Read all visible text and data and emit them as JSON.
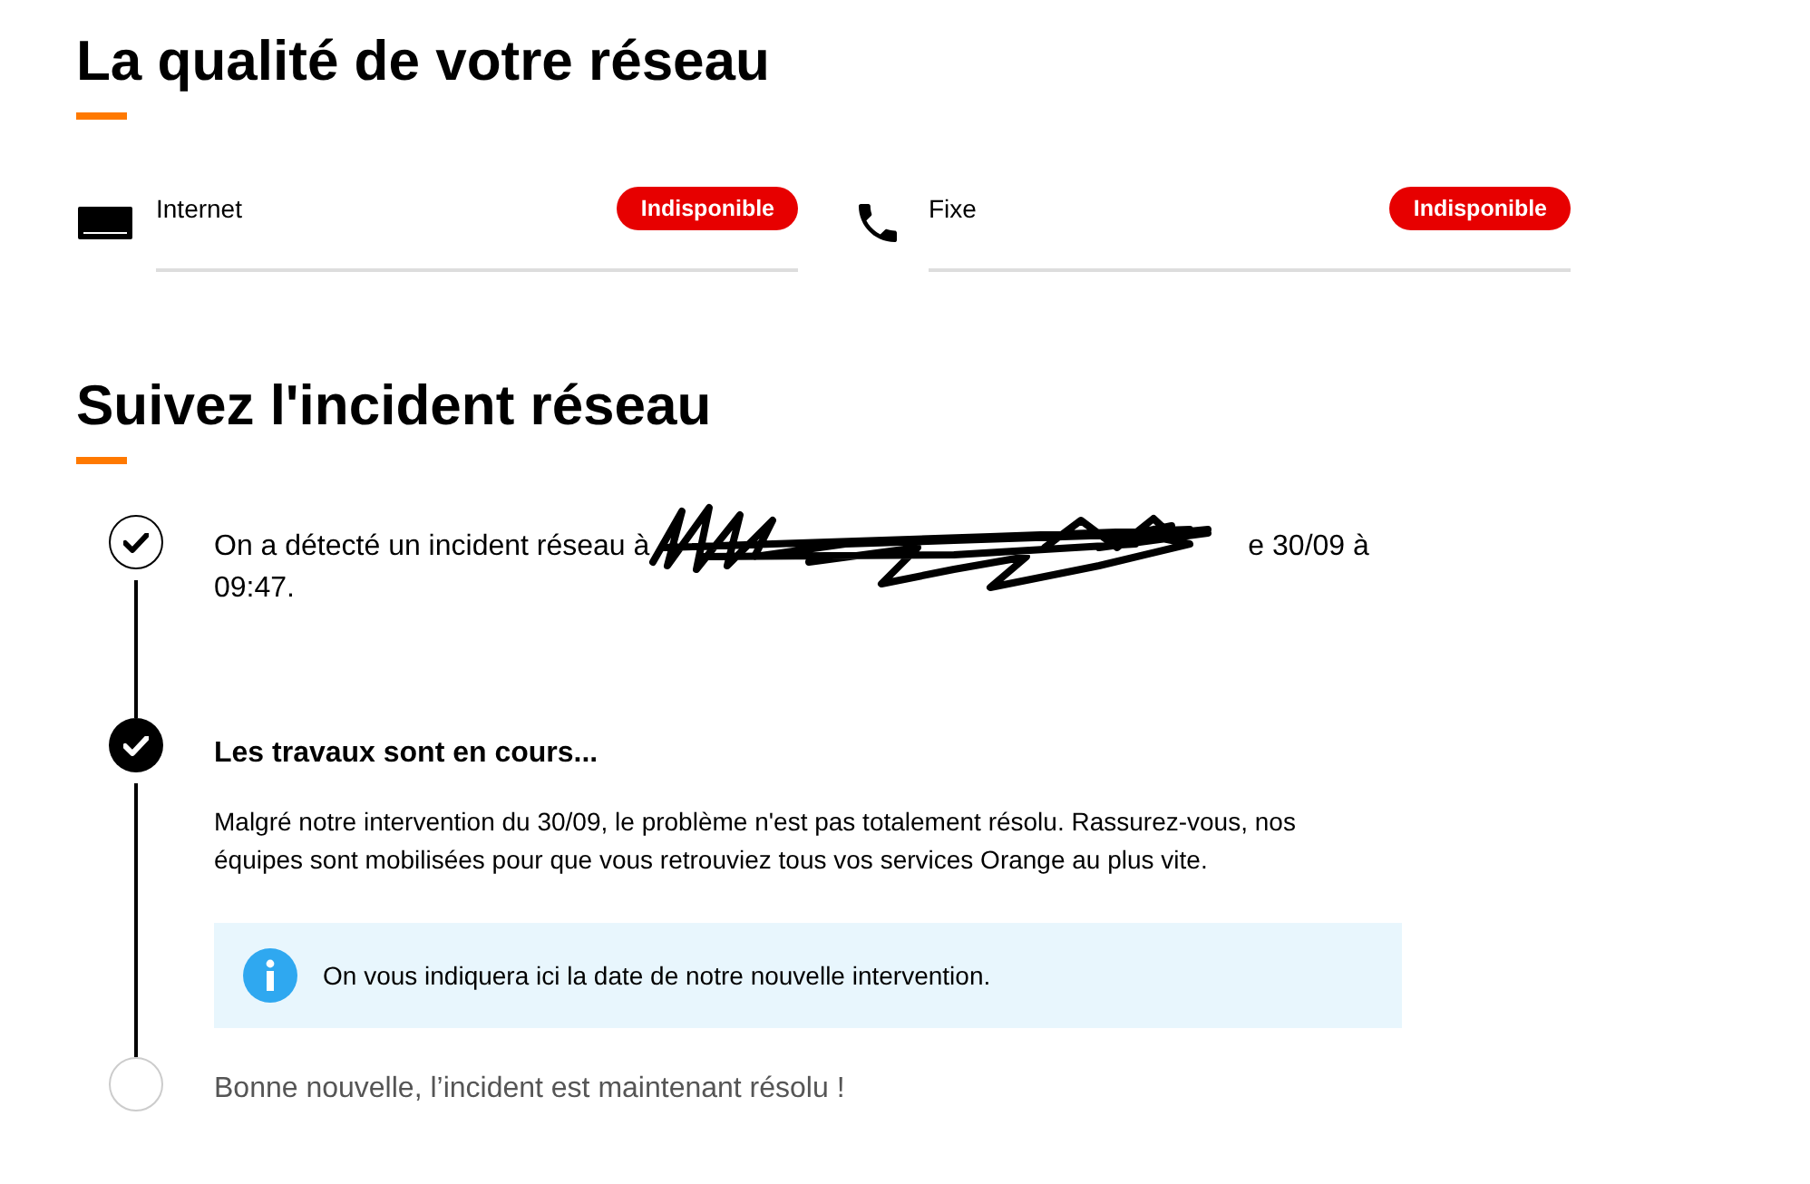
{
  "quality": {
    "title": "La qualité de votre réseau",
    "services": [
      {
        "kind": "internet",
        "label": "Internet",
        "status": "Indisponible"
      },
      {
        "kind": "phone",
        "label": "Fixe",
        "status": "Indisponible"
      }
    ]
  },
  "incident": {
    "title": "Suivez l'incident réseau",
    "steps": [
      {
        "checked": true,
        "active": false,
        "text_start": "On a détecté un incident réseau à",
        "text_after": "e 30/09 à",
        "text_wrap": "09:47."
      },
      {
        "checked": true,
        "active": true,
        "title": "Les travaux sont en cours...",
        "description": "Malgré notre intervention du 30/09, le problème n'est pas totalement résolu. Rassurez-vous, nos équipes sont mobilisées pour que vous retrouviez tous vos services Orange au plus vite.",
        "info": "On vous indiquera ici la date de notre nouvelle intervention."
      },
      {
        "checked": false,
        "active": false,
        "text_start": "Bonne nouvelle, l’incident est maintenant résolu !"
      }
    ]
  }
}
